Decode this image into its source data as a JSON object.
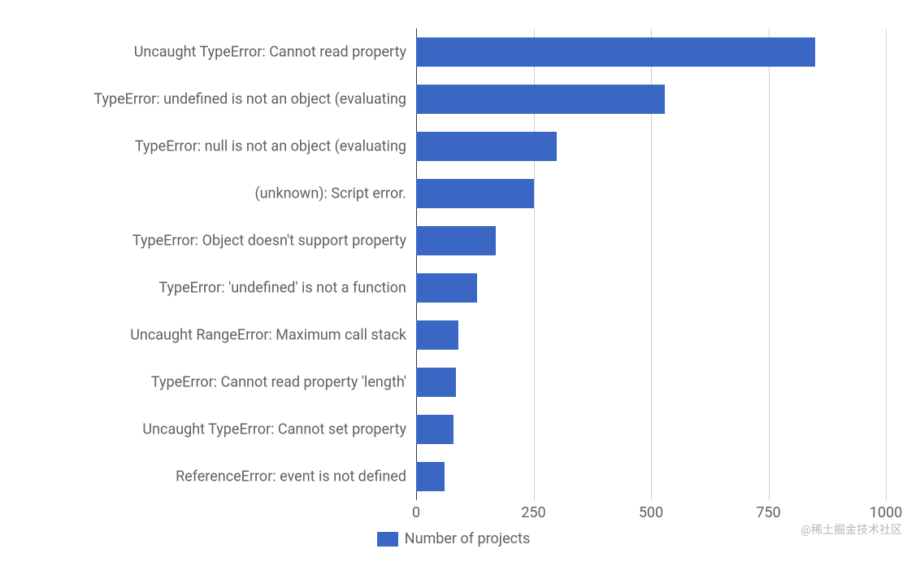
{
  "chart_data": {
    "type": "bar",
    "orientation": "horizontal",
    "categories": [
      "Uncaught TypeError: Cannot read property",
      "TypeError: undefined is not an object (evaluating",
      "TypeError: null is not an object (evaluating",
      "(unknown): Script error.",
      "TypeError: Object doesn't support property",
      "TypeError: 'undefined' is not a function",
      "Uncaught RangeError: Maximum call stack",
      "TypeError: Cannot read property 'length'",
      "Uncaught TypeError: Cannot set property",
      "ReferenceError: event is not defined"
    ],
    "values": [
      850,
      530,
      300,
      250,
      170,
      130,
      90,
      85,
      80,
      60
    ],
    "series_name": "Number of projects",
    "xlabel": "",
    "ylabel": "",
    "xlim": [
      0,
      1000
    ],
    "x_ticks": [
      0,
      250,
      500,
      750,
      1000
    ],
    "bar_color": "#3a67c4",
    "grid_color": "#cfcfcf"
  },
  "legend": {
    "label": "Number of projects"
  },
  "watermark": "@稀土掘金技术社区"
}
